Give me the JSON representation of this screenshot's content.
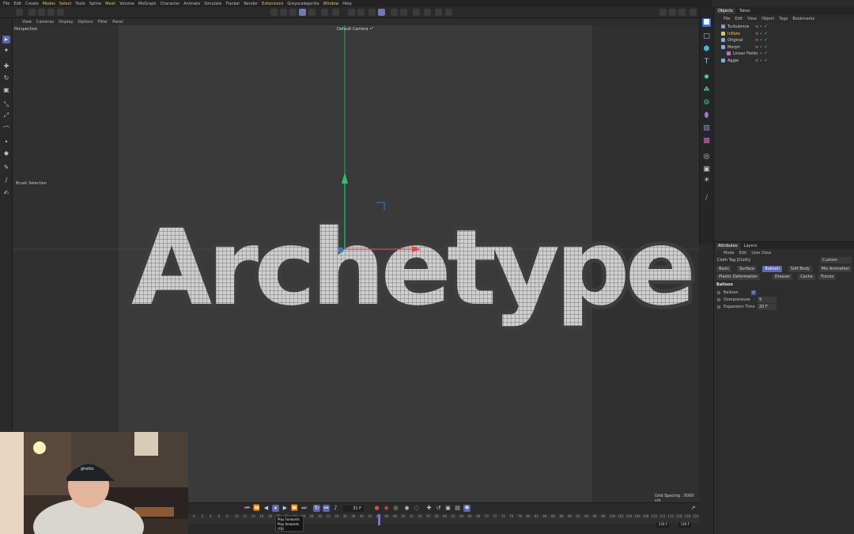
{
  "menubar": [
    "File",
    "Edit",
    "Create",
    "Modes",
    "Select",
    "Tools",
    "Spline",
    "Mesh",
    "Volume",
    "MoGraph",
    "Character",
    "Animate",
    "Simulate",
    "Tracker",
    "Render",
    "Extensions",
    "Greyscalegorilla",
    "Window",
    "Help"
  ],
  "menubar_highlight": [
    "Modes",
    "Select",
    "Mesh",
    "Extensions",
    "Window"
  ],
  "viewport": {
    "menu": [
      "View",
      "Cameras",
      "Display",
      "Options",
      "Filter",
      "Panel"
    ],
    "view_name": "Perspective",
    "camera": "Default Camera",
    "camera_suffix": "•°",
    "brush_selection": "Brush Selection",
    "grid_spacing": "Grid Spacing : 5000 cm",
    "title_text": "Archetype"
  },
  "objects": {
    "tabs": [
      "Objects",
      "Takes"
    ],
    "menu": [
      "File",
      "Edit",
      "View",
      "Object",
      "Tags",
      "Bookmarks"
    ],
    "rows": [
      {
        "name": "Turbulence",
        "selected": false,
        "color": "#6fa0d8"
      },
      {
        "name": "Inflate",
        "selected": true,
        "color": "#f2c14e"
      },
      {
        "name": "Original",
        "selected": false,
        "color": "#7ab0e0"
      },
      {
        "name": "Morph",
        "selected": false,
        "color": "#7ab0e0"
      },
      {
        "name": "Linear Field",
        "selected": false,
        "color": "#c070d0"
      },
      {
        "name": "Aggie",
        "selected": false,
        "color": "#7ab0e0"
      }
    ]
  },
  "attributes": {
    "tabs": [
      "Attributes",
      "Layers"
    ],
    "menu": [
      "Mode",
      "Edit",
      "User Data"
    ],
    "title": "Cloth Tag [Cloth]",
    "mode_select": "Custom",
    "subtabs_row1": [
      "Basic",
      "Surface",
      "Balloon",
      "Soft Body",
      "Mix Animation"
    ],
    "subtabs_row2": [
      "Plastic Deformation",
      "Dresser",
      "Cache",
      "Forces"
    ],
    "active_subtab": "Balloon",
    "section": "Balloon",
    "props": [
      {
        "label": "Balloon",
        "value": "✓",
        "type": "check"
      },
      {
        "label": "Overpressure",
        "value": "9",
        "type": "value"
      },
      {
        "label": "Expansion Time",
        "value": "20 F",
        "type": "value"
      }
    ]
  },
  "timeline": {
    "current_frame": "31 F",
    "end_frame_1": "120 F",
    "end_frame_2": "120 F",
    "ticks": [
      "0",
      "2",
      "4",
      "6",
      "8",
      "10",
      "12",
      "14",
      "16",
      "18",
      "20",
      "22",
      "24",
      "26",
      "28",
      "30",
      "32",
      "34",
      "36",
      "38",
      "40",
      "42",
      "44",
      "46",
      "48",
      "50",
      "52",
      "54",
      "56",
      "58",
      "60",
      "62",
      "64",
      "66",
      "68",
      "70",
      "72",
      "74",
      "76",
      "78",
      "80",
      "82",
      "84",
      "86",
      "88",
      "90",
      "92",
      "94",
      "96",
      "98",
      "100",
      "102",
      "104",
      "106",
      "108",
      "110",
      "112",
      "114",
      "116",
      "118",
      "120"
    ],
    "tooltip": {
      "title": "Play Forwards",
      "desc": "Play forwards",
      "key": "(F8)"
    }
  },
  "webcam": {
    "cap_text": "ghetto"
  },
  "colors": {
    "accent": "#5f6ab3",
    "axis_y": "#2ec26a",
    "axis_x": "#e04848",
    "selected": "#f2c14e"
  }
}
